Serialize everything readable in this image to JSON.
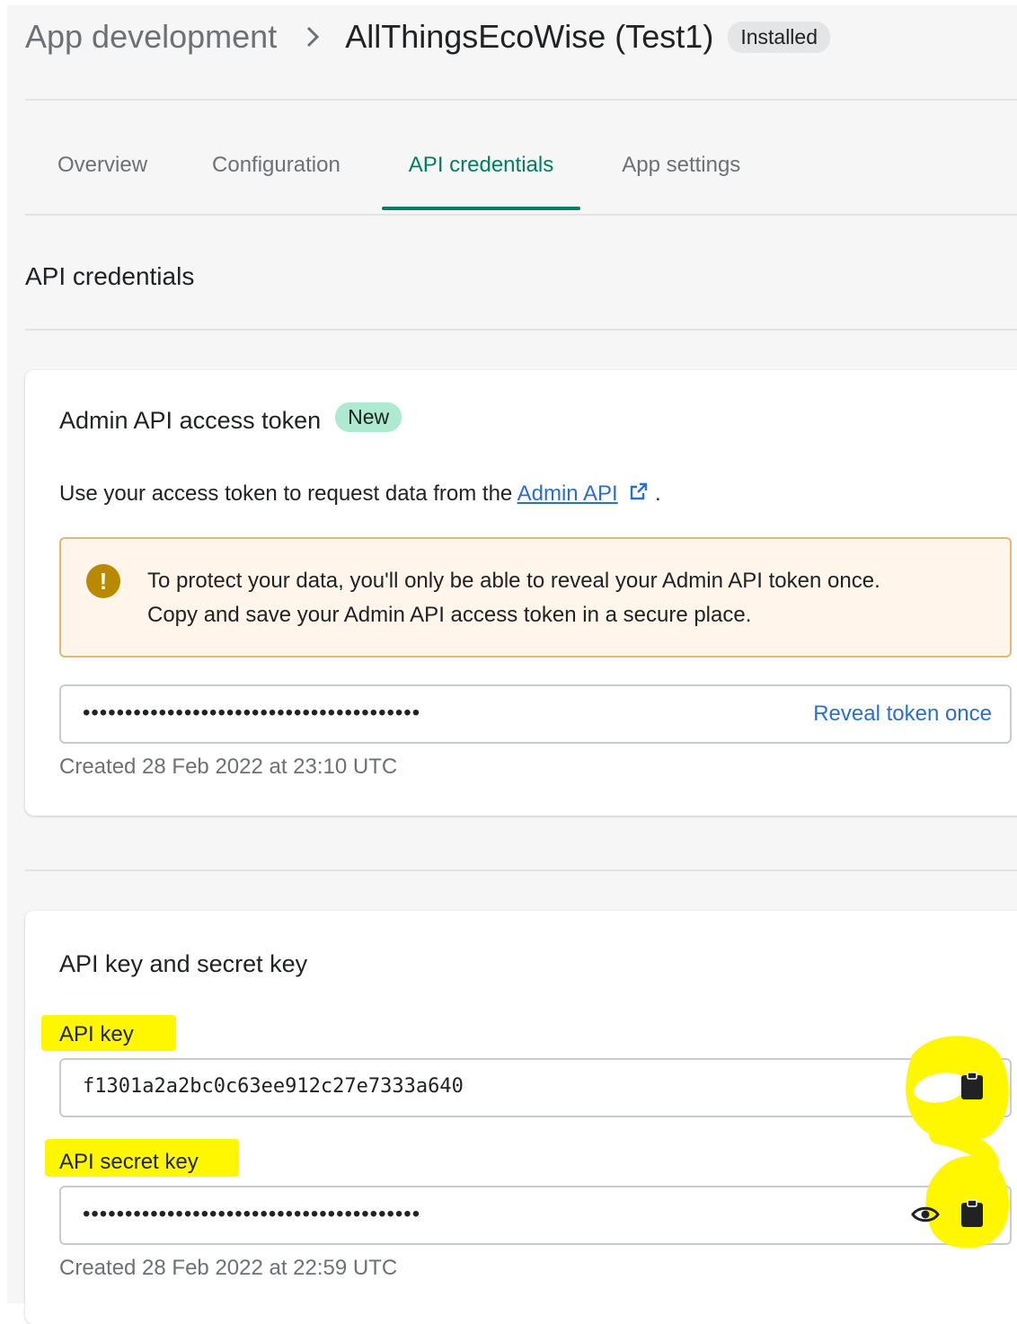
{
  "header": {
    "breadcrumb": "App development",
    "app_name": "AllThingsEcoWise (Test1)",
    "status_badge": "Installed"
  },
  "tabs": [
    {
      "label": "Overview",
      "active": false
    },
    {
      "label": "Configuration",
      "active": false
    },
    {
      "label": "API credentials",
      "active": true
    },
    {
      "label": "App settings",
      "active": false
    }
  ],
  "section_title": "API credentials",
  "admin_token_card": {
    "title": "Admin API access token",
    "badge": "New",
    "description_prefix": "Use your access token to request data from the",
    "link_text": "Admin API",
    "description_suffix": ".",
    "warning_line1": "To protect your data, you'll only be able to reveal your Admin API token once.",
    "warning_line2": "Copy and save your Admin API access token in a secure place.",
    "token_masked": "••••••••••••••••••••••••••••••••••••••••",
    "reveal_label": "Reveal token once",
    "created": "Created 28 Feb 2022 at 23:10 UTC"
  },
  "api_keys_card": {
    "title": "API key and secret key",
    "api_key_label": "API key",
    "api_key_value": "f1301a2a2bc0c63ee912c27e7333a640",
    "secret_key_label": "API secret key",
    "secret_key_masked": "••••••••••••••••••••••••••••••••••••••••",
    "created": "Created 28 Feb 2022 at 22:59 UTC"
  },
  "icons": [
    "chevron-right-icon",
    "alert-circle-icon",
    "external-link-icon",
    "clipboard-icon",
    "eye-icon"
  ],
  "colors": {
    "accent": "#008060",
    "link": "#2c6ecb",
    "warning_bg": "#fff5ea",
    "highlight": "#fff700",
    "new_badge": "#aee9d1"
  }
}
